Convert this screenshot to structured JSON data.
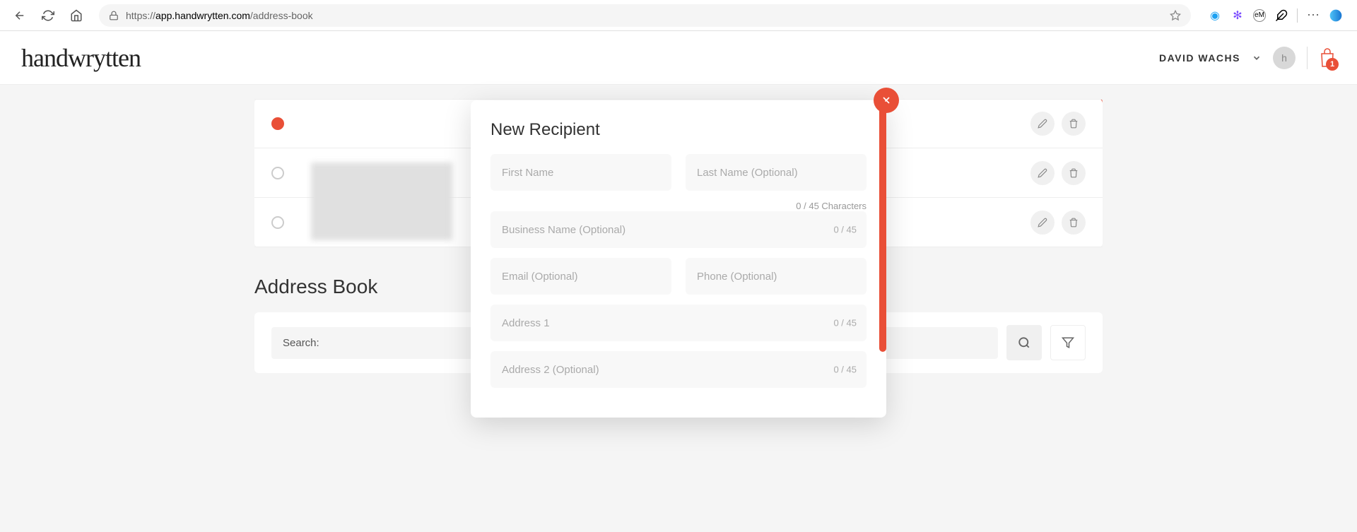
{
  "browser": {
    "url_prefix": "https://",
    "url_domain": "app.handwrytten.com",
    "url_path": "/address-book"
  },
  "header": {
    "logo": "handwrytten",
    "user_name": "DAVID WACHS",
    "cart_count": "1"
  },
  "main": {
    "section_title": "Address Book",
    "search_label": "Search:"
  },
  "modal": {
    "title": "New Recipient",
    "fields": {
      "first_name": "First Name",
      "last_name": "Last Name (Optional)",
      "name_counter": "0 / 45 Characters",
      "business": "Business Name (Optional)",
      "business_counter": "0 / 45",
      "email": "Email (Optional)",
      "phone": "Phone (Optional)",
      "address1": "Address 1",
      "address1_counter": "0 / 45",
      "address2": "Address 2 (Optional)",
      "address2_counter": "0 / 45"
    }
  }
}
